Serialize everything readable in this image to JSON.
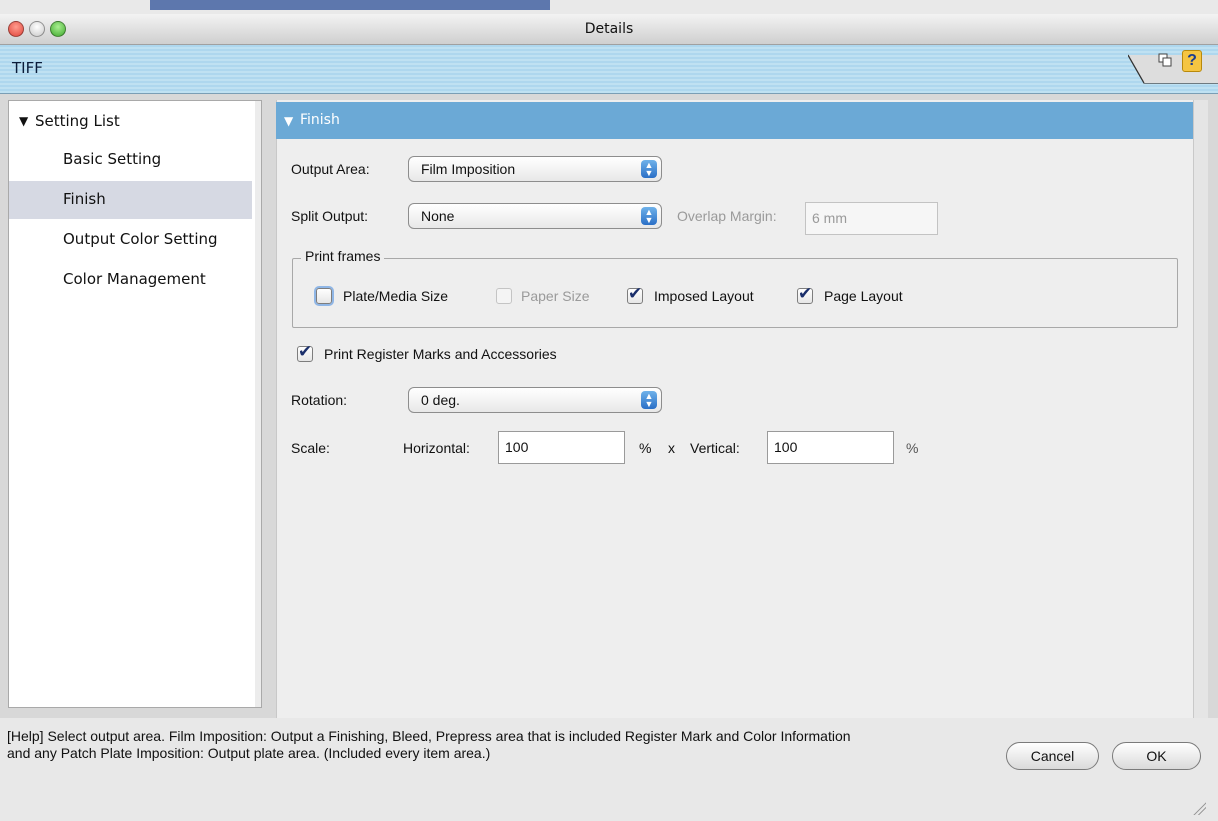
{
  "window": {
    "title": "Details"
  },
  "header": {
    "tab_label": "TIFF"
  },
  "sidebar": {
    "root_label": "Setting List",
    "items": [
      {
        "label": "Basic Setting",
        "selected": false
      },
      {
        "label": "Finish",
        "selected": true
      },
      {
        "label": "Output Color Setting",
        "selected": false
      },
      {
        "label": "Color Management",
        "selected": false
      }
    ]
  },
  "main": {
    "section_title": "Finish",
    "output_area": {
      "label": "Output Area:",
      "value": "Film Imposition"
    },
    "split_output": {
      "label": "Split Output:",
      "value": "None"
    },
    "overlap_margin": {
      "label": "Overlap Margin:",
      "value": "6 mm"
    },
    "print_frames": {
      "legend": "Print frames",
      "options": [
        {
          "label": "Plate/Media Size",
          "checked": false,
          "enabled": true
        },
        {
          "label": "Paper Size",
          "checked": false,
          "enabled": false
        },
        {
          "label": "Imposed Layout",
          "checked": true,
          "enabled": true
        },
        {
          "label": "Page Layout",
          "checked": true,
          "enabled": true
        }
      ]
    },
    "register_marks": {
      "label": "Print Register Marks and Accessories",
      "checked": true
    },
    "rotation": {
      "label": "Rotation:",
      "value": "0 deg."
    },
    "scale": {
      "label": "Scale:",
      "horizontal_label": "Horizontal:",
      "horizontal_value": "100",
      "percent1": "%",
      "x": "x",
      "vertical_label": "Vertical:",
      "vertical_value": "100",
      "percent2": "%"
    }
  },
  "help": {
    "line1": "[Help] Select output area.  Film Imposition: Output a Finishing, Bleed, Prepress area that is included Register Mark and Color Information",
    "line2": "and any Patch  Plate Imposition: Output plate area. (Included every item area.)"
  },
  "buttons": {
    "cancel": "Cancel",
    "ok": "OK"
  },
  "icons": {
    "triangle": "▼",
    "question": "?"
  },
  "colors": {
    "section_header": "#6ba9d6",
    "tiff_bar": "#bfe1f2",
    "selected_item": "#d6d9e3"
  }
}
